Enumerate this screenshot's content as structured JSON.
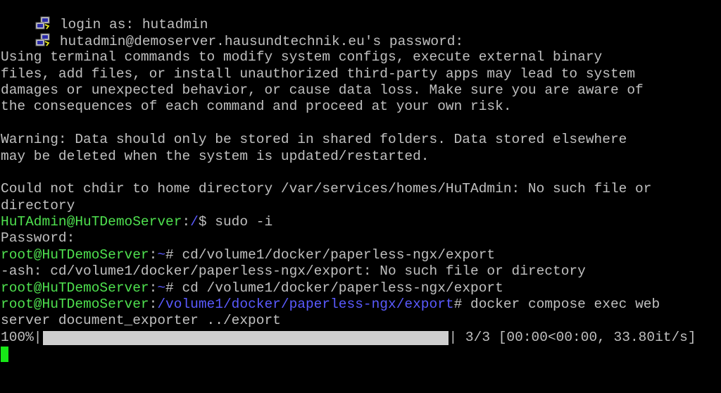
{
  "colors": {
    "background": "#000000",
    "text": "#c0c0c0",
    "prompt_green": "#4fe14f",
    "path_blue": "#5a5aff",
    "cursor": "#17e817",
    "progress_fill": "#cfcfcf"
  },
  "icons": [
    "putty-login-icon",
    "putty-password-icon"
  ],
  "login": {
    "prompt_text": "login as: hutadmin",
    "password_text": "hutadmin@demoserver.hausundtechnik.eu's password:"
  },
  "warning1": [
    "Using terminal commands to modify system configs, execute external binary",
    "files, add files, or install unauthorized third-party apps may lead to system",
    "damages or unexpected behavior, or cause data loss. Make sure you are aware of",
    "the consequences of each command and proceed at your own risk."
  ],
  "warning2": [
    "Warning: Data should only be stored in shared folders. Data stored elsewhere",
    "may be deleted when the system is updated/restarted."
  ],
  "chdir": [
    "Could not chdir to home directory /var/services/homes/HuTAdmin: No such file or",
    "directory"
  ],
  "session": {
    "line1_user": "HuTAdmin@HuTDemoServer",
    "line1_sep": ":",
    "line1_path": "/",
    "line1_cmd": "$ sudo -i",
    "password_prompt": "Password:",
    "line3_user": "root@HuTDemoServer",
    "line3_sep": ":",
    "line3_path": "~",
    "line3_cmd": "# cd/volume1/docker/paperless-ngx/export",
    "error_line": "-ash: cd/volume1/docker/paperless-ngx/export: No such file or directory",
    "line5_user": "root@HuTDemoServer",
    "line5_sep": ":",
    "line5_path": "~",
    "line5_cmd": "# cd /volume1/docker/paperless-ngx/export",
    "line6_user": "root@HuTDemoServer",
    "line6_sep": ":",
    "line6_path": "/volume1/docker/paperless-ngx/export",
    "line6_cmd": "# docker compose exec web",
    "line7_cont": "server document_exporter ../export"
  },
  "progress": {
    "percent_label": "100%|",
    "value": 1.0,
    "suffix": "| 3/3 [00:00<00:00, 33.80it/s]"
  }
}
